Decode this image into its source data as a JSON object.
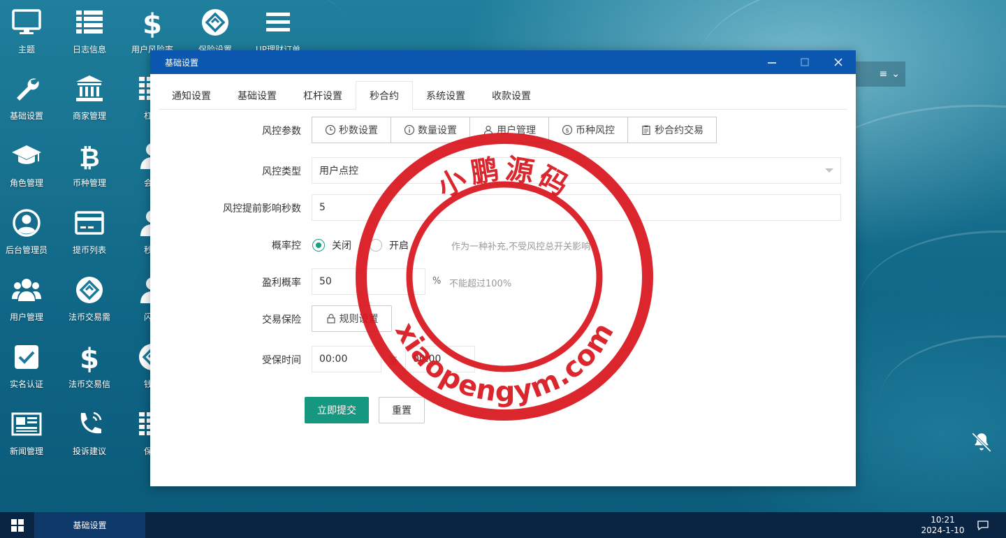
{
  "desktop": {
    "icons": [
      {
        "label": "主题",
        "icon": "monitor-icon"
      },
      {
        "label": "日志信息",
        "icon": "list-icon"
      },
      {
        "label": "用户风险率",
        "icon": "dollar-icon"
      },
      {
        "label": "保险设置",
        "icon": "diamond-logo-icon"
      },
      {
        "label": "UP理财订单",
        "icon": "menu-icon"
      },
      {
        "label": "基础设置",
        "icon": "wrench-icon"
      },
      {
        "label": "商家管理",
        "icon": "bank-icon"
      },
      {
        "label": "杠杆",
        "icon": "list-icon"
      },
      {
        "label": "角色管理",
        "icon": "graduation-cap-icon"
      },
      {
        "label": "币种管理",
        "icon": "bitcoin-icon"
      },
      {
        "label": "会员",
        "icon": "user-icon"
      },
      {
        "label": "后台管理员",
        "icon": "user-circle-icon"
      },
      {
        "label": "提币列表",
        "icon": "credit-card-icon"
      },
      {
        "label": "秒合",
        "icon": "user-icon"
      },
      {
        "label": "用户管理",
        "icon": "users-icon"
      },
      {
        "label": "法币交易需",
        "icon": "diamond-logo-icon"
      },
      {
        "label": "闪兑",
        "icon": "user-icon"
      },
      {
        "label": "实名认证",
        "icon": "check-square-icon"
      },
      {
        "label": "法币交易信",
        "icon": "dollar-icon"
      },
      {
        "label": "钱包",
        "icon": "diamond-logo-icon"
      },
      {
        "label": "新闻管理",
        "icon": "newspaper-icon"
      },
      {
        "label": "投诉建议",
        "icon": "phone-icon"
      },
      {
        "label": "保险",
        "icon": "list-icon"
      }
    ]
  },
  "window": {
    "title": "基础设置",
    "tabs": [
      {
        "label": "通知设置"
      },
      {
        "label": "基础设置"
      },
      {
        "label": "杠杆设置"
      },
      {
        "label": "秒合约",
        "active": true
      },
      {
        "label": "系统设置"
      },
      {
        "label": "收款设置"
      }
    ],
    "form": {
      "risk_params_label": "风控参数",
      "risk_buttons": [
        {
          "label": "秒数设置",
          "icon": "clock-icon"
        },
        {
          "label": "数量设置",
          "icon": "info-icon"
        },
        {
          "label": "用户管理",
          "icon": "user-outline-icon"
        },
        {
          "label": "币种风控",
          "icon": "dollar-circle-icon"
        },
        {
          "label": "秒合约交易",
          "icon": "clipboard-icon"
        }
      ],
      "risk_type_label": "风控类型",
      "risk_type_value": "用户点控",
      "advance_seconds_label": "风控提前影响秒数",
      "advance_seconds_value": "5",
      "probability_label": "概率控",
      "probability_off": "关闭",
      "probability_on": "开启",
      "probability_selected": "关闭",
      "probability_hint": "作为一种补充,不受风控总开关影响",
      "profit_rate_label": "盈利概率",
      "profit_rate_value": "50",
      "profit_rate_unit": "%",
      "profit_rate_hint": "不能超过100%",
      "insurance_label": "交易保险",
      "insurance_button": "规则设置",
      "insured_time_label": "受保时间",
      "insured_time_start": "00:00",
      "insured_time_sep": "至",
      "insured_time_end": "00:00",
      "submit_label": "立即提交",
      "reset_label": "重置"
    }
  },
  "stamp": {
    "top_text": "小鹏源码",
    "bottom_text": "xiaopengym.com",
    "color": "#d8141c"
  },
  "taskbar": {
    "active_window": "基础设置",
    "time": "10:21",
    "date": "2024-1-10"
  }
}
